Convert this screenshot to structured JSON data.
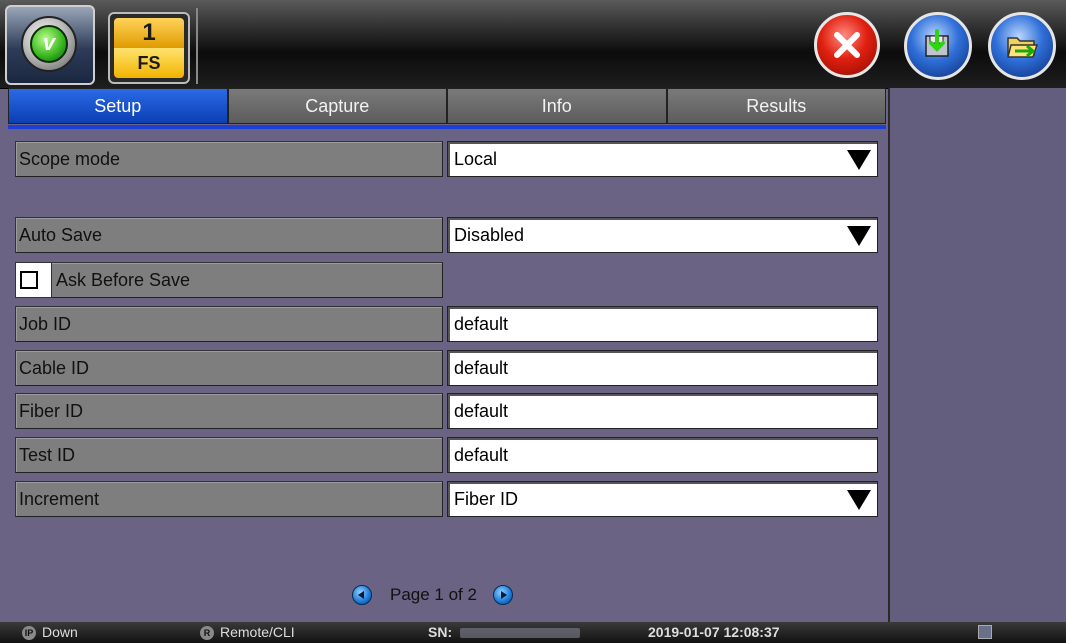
{
  "header": {
    "fs_number": "1",
    "fs_label": "FS",
    "logo_letter": "v"
  },
  "tabs": [
    {
      "label": "Setup",
      "active": true
    },
    {
      "label": "Capture",
      "active": false
    },
    {
      "label": "Info",
      "active": false
    },
    {
      "label": "Results",
      "active": false
    }
  ],
  "form": {
    "scope_mode": {
      "label": "Scope mode",
      "value": "Local"
    },
    "auto_save": {
      "label": "Auto Save",
      "value": "Disabled"
    },
    "ask_before_save": {
      "label": "Ask Before Save",
      "checked": false
    },
    "job_id": {
      "label": "Job ID",
      "value": "default"
    },
    "cable_id": {
      "label": "Cable ID",
      "value": "default"
    },
    "fiber_id": {
      "label": "Fiber ID",
      "value": "default"
    },
    "test_id": {
      "label": "Test ID",
      "value": "default"
    },
    "increment": {
      "label": "Increment",
      "value": "Fiber ID"
    }
  },
  "pager": {
    "text": "Page 1 of 2"
  },
  "status": {
    "ip_badge": "IP",
    "ip_status": "Down",
    "remote_badge": "R",
    "remote": "Remote/CLI",
    "sn_label": "SN:",
    "datetime": "2019-01-07 12:08:37"
  },
  "colors": {
    "background": "#6a6383",
    "active_tab": "#0b3fb4",
    "close_button": "#e02010"
  }
}
